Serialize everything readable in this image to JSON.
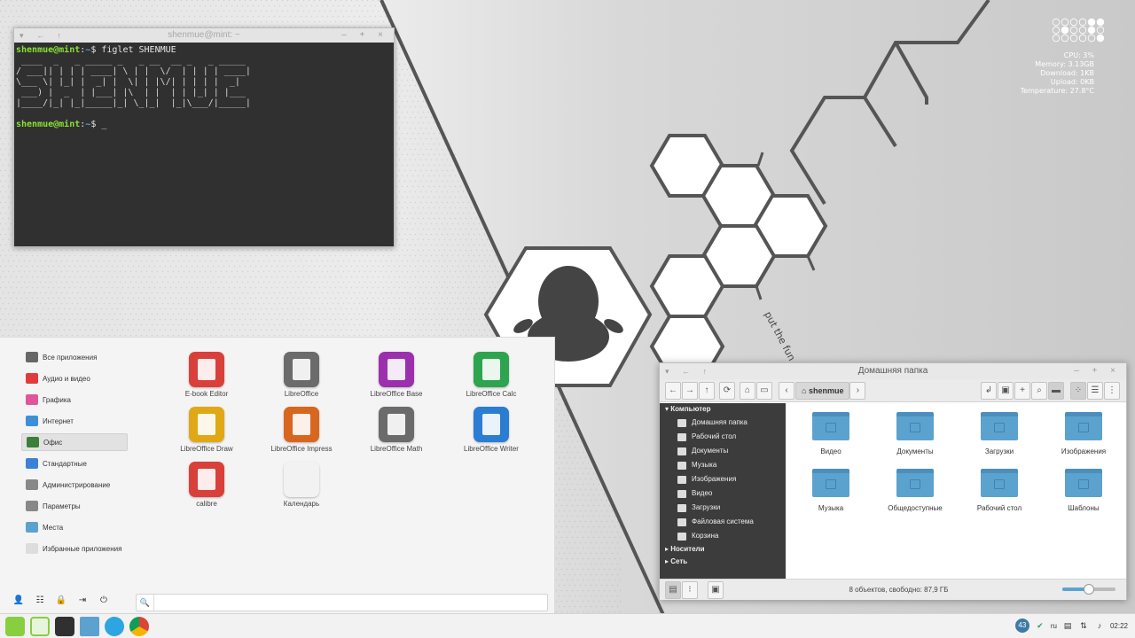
{
  "colors": {
    "accent": "#5ca2cf",
    "mint": "#87cf3e",
    "terminal_bg": "#303030",
    "sidebar_bg": "#3c3c3c"
  },
  "wallpaper": {
    "slogan": "put the fun"
  },
  "conky": {
    "cpu": "CPU: 3%",
    "memory": "Memory: 3.13GB",
    "download": "Download: 1KB",
    "upload": "Upload: 0KB",
    "temperature": "Temperature: 27.8°C"
  },
  "terminal": {
    "title": "shenmue@mint: ~",
    "user": "shenmue@mint",
    "path": "~",
    "symbol": "$",
    "command": "figlet SHENMUE",
    "ascii": [
      " ____  _   _ _____ _   _ __  __ _   _ _____ ",
      "/ ___|| | | | ____| \\ | |  \\/  | | | | ____|",
      "\\___ \\| |_| |  _| |  \\| | |\\/| | | | |  _|  ",
      " ___) |  _  | |___| |\\  | |  | | |_| | |___ ",
      "|____/|_| |_|_____|_| \\_|_|  |_|\\___/|_____|"
    ],
    "cursor": "_"
  },
  "menu": {
    "categories": [
      {
        "label": "Все приложения",
        "icon": "monitor-icon",
        "color": "#666"
      },
      {
        "label": "Аудио и видео",
        "icon": "play-icon",
        "color": "#e23b3b"
      },
      {
        "label": "Графика",
        "icon": "palette-icon",
        "color": "#e0569b"
      },
      {
        "label": "Интернет",
        "icon": "cloud-icon",
        "color": "#3d8fd6"
      },
      {
        "label": "Офис",
        "icon": "office-icon",
        "color": "#3a7f3a"
      },
      {
        "label": "Стандартные",
        "icon": "scissors-icon",
        "color": "#3b82d6"
      },
      {
        "label": "Администрирование",
        "icon": "admin-icon",
        "color": "#888"
      },
      {
        "label": "Параметры",
        "icon": "settings-icon",
        "color": "#888"
      },
      {
        "label": "Места",
        "icon": "folder-icon",
        "color": "#5ca2cf"
      },
      {
        "label": "Избранные приложения",
        "icon": "star-icon",
        "color": "#ddd"
      }
    ],
    "active_category": "Офис",
    "apps": [
      {
        "label": "E-book Editor",
        "color": "#d9403a"
      },
      {
        "label": "LibreOffice",
        "color": "#6b6b6b"
      },
      {
        "label": "LibreOffice Base",
        "color": "#9b2fae"
      },
      {
        "label": "LibreOffice Calc",
        "color": "#2ea44f"
      },
      {
        "label": "LibreOffice Draw",
        "color": "#e0a817"
      },
      {
        "label": "LibreOffice Impress",
        "color": "#d9661e"
      },
      {
        "label": "LibreOffice Math",
        "color": "#6b6b6b"
      },
      {
        "label": "LibreOffice Writer",
        "color": "#2b7cd3"
      },
      {
        "label": "calibre",
        "color": "#d9403a"
      },
      {
        "label": "Календарь",
        "color": "#f2f2f2"
      }
    ],
    "search": {
      "value": "",
      "placeholder": ""
    }
  },
  "filemanager": {
    "title": "Домашняя папка",
    "location": "shenmue",
    "sections": [
      {
        "label": "Компьютер",
        "items": [
          "Домашняя папка",
          "Рабочий стол",
          "Документы",
          "Музыка",
          "Изображения",
          "Видео",
          "Загрузки",
          "Файловая система",
          "Корзина"
        ]
      },
      {
        "label": "Носители",
        "items": []
      },
      {
        "label": "Сеть",
        "items": []
      }
    ],
    "folders": [
      {
        "label": "Видео",
        "icon": "video-folder-icon"
      },
      {
        "label": "Документы",
        "icon": "documents-folder-icon"
      },
      {
        "label": "Загрузки",
        "icon": "downloads-folder-icon"
      },
      {
        "label": "Изображения",
        "icon": "pictures-folder-icon"
      },
      {
        "label": "Музыка",
        "icon": "music-folder-icon"
      },
      {
        "label": "Общедоступные",
        "icon": "share-folder-icon"
      },
      {
        "label": "Рабочий стол",
        "icon": "desktop-folder-icon"
      },
      {
        "label": "Шаблоны",
        "icon": "templates-folder-icon"
      }
    ],
    "status": "8 объектов, свободно: 87,9 ГБ",
    "zoom_level": 0.5
  },
  "taskbar": {
    "apps": [
      "mint-menu-icon",
      "show-desktop-icon",
      "terminal-icon",
      "files-icon",
      "telegram-icon",
      "chrome-icon"
    ],
    "updates_badge": "43",
    "language": "ru",
    "clock": "02:22"
  }
}
